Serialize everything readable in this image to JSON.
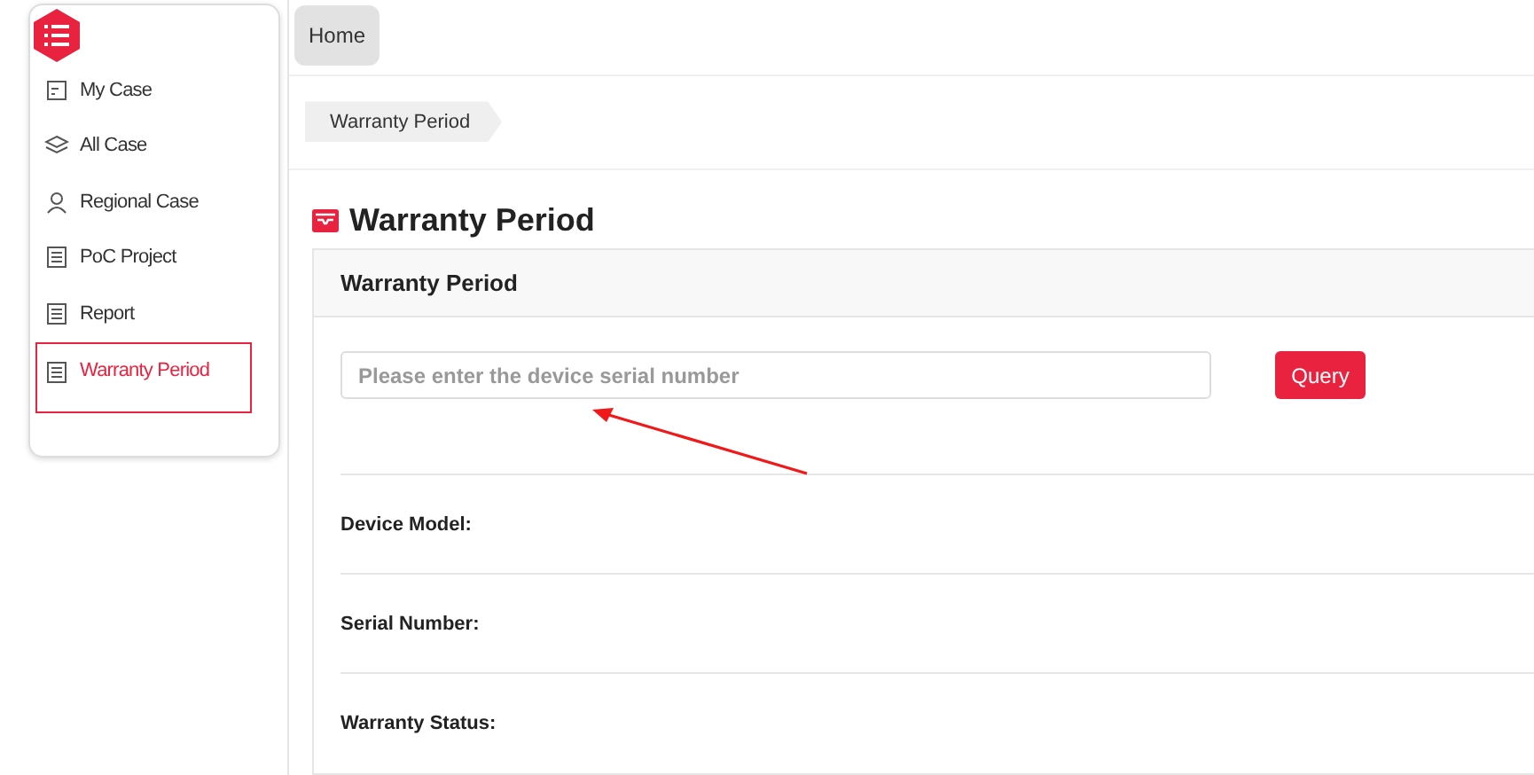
{
  "sidebar": {
    "items": [
      {
        "label": "My Case",
        "selected": false
      },
      {
        "label": "All Case",
        "selected": false
      },
      {
        "label": "Regional Case",
        "selected": false
      },
      {
        "label": "PoC Project",
        "selected": false
      },
      {
        "label": "Report",
        "selected": false
      },
      {
        "label": "Warranty Period",
        "selected": true
      }
    ]
  },
  "tabs": [
    {
      "label": "Home",
      "selected": true
    }
  ],
  "breadcrumb": [
    "Warranty Period"
  ],
  "page_title": "Warranty Period",
  "panel": {
    "title": "Warranty Period",
    "search": {
      "placeholder": "Please enter the device serial number"
    },
    "button": "Query",
    "fields": [
      {
        "label": "Device Model:"
      },
      {
        "label": "Serial Number:"
      },
      {
        "label": "Warranty Status:"
      }
    ]
  }
}
